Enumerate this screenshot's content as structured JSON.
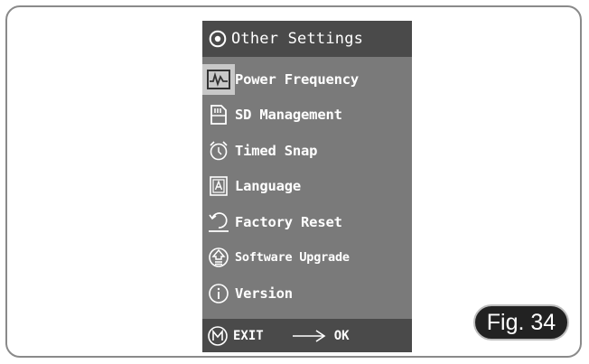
{
  "header": {
    "icon": "settings-circle-icon",
    "title": "Other Settings"
  },
  "menu": {
    "items": [
      {
        "icon": "power-frequency-icon",
        "label": "Power Frequency",
        "selected": true
      },
      {
        "icon": "sd-card-icon",
        "label": "SD Management"
      },
      {
        "icon": "clock-icon",
        "label": "Timed Snap"
      },
      {
        "icon": "language-icon",
        "label": "Language"
      },
      {
        "icon": "reset-icon",
        "label": "Factory Reset"
      },
      {
        "icon": "upgrade-icon",
        "label": "Software Upgrade"
      },
      {
        "icon": "info-icon",
        "label": "Version"
      }
    ]
  },
  "footer": {
    "exit_icon": "m-button-icon",
    "exit_label": "EXIT",
    "arrow_icon": "arrow-right-icon",
    "ok_label": "OK"
  },
  "figure_label": "Fig. 34",
  "colors": {
    "screen": "#7a7a7a",
    "bar": "#4a4a4a",
    "selected_icon_bg": "#c8c8c8",
    "text": "#ffffff"
  }
}
